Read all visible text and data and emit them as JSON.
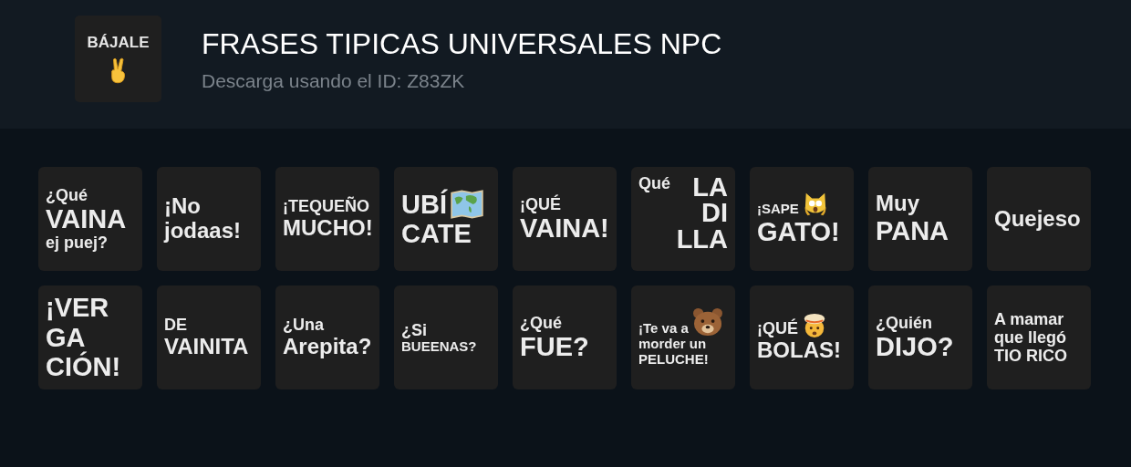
{
  "pack": {
    "cover": {
      "label": "BÁJALE"
    },
    "title": "FRASES TIPICAS UNIVERSALES NPC",
    "subtitle": "Descarga usando el ID: Z83ZK"
  },
  "stickers": [
    {
      "lines": [
        "¿Qué",
        "VAINA",
        "ej puej?"
      ]
    },
    {
      "lines": [
        "¡No",
        "jodaas!"
      ]
    },
    {
      "lines": [
        "¡TEQUEÑO",
        "MUCHO!"
      ]
    },
    {
      "lines": [
        "UBÍ",
        "CATE"
      ]
    },
    {
      "lines": [
        "¡QUÉ",
        "VAINA!"
      ]
    },
    {
      "lines": [
        "Qué",
        "LA",
        "DI",
        "LLA"
      ]
    },
    {
      "lines": [
        "¡SAPE",
        "GATO!"
      ]
    },
    {
      "lines": [
        "Muy",
        "PANA"
      ]
    },
    {
      "lines": [
        "Quejeso"
      ]
    },
    {
      "lines": [
        "¡VER",
        "GA",
        "CIÓN!"
      ]
    },
    {
      "lines": [
        "DE",
        "VAINITA"
      ]
    },
    {
      "lines": [
        "¿Una",
        "Arepita?"
      ]
    },
    {
      "lines": [
        "¿Si",
        "BUEENAS?"
      ]
    },
    {
      "lines": [
        "¿Qué",
        "FUE?"
      ]
    },
    {
      "lines": [
        "¡Te va a",
        "morder un",
        "PELUCHE!"
      ]
    },
    {
      "lines": [
        "¡QUÉ",
        "BOLAS!"
      ]
    },
    {
      "lines": [
        "¿Quién",
        "DIJO?"
      ]
    },
    {
      "lines": [
        "A mamar",
        "que llegó",
        "TIO RICO"
      ]
    }
  ]
}
